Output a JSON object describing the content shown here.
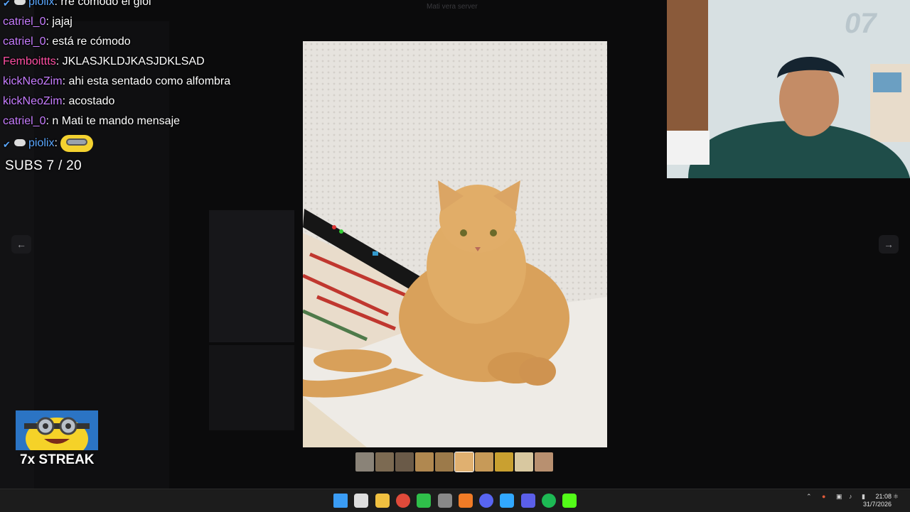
{
  "viewer": {
    "title": "Mati vera server"
  },
  "chat": [
    {
      "user": "piolix",
      "message": "rre comodo el giol",
      "color": "#5aa7ff",
      "badges": true
    },
    {
      "user": "catriel_0",
      "message": "jajaj",
      "color": "#c77dff"
    },
    {
      "user": "catriel_0",
      "message": "está re cómodo",
      "color": "#c77dff"
    },
    {
      "user": "Femboittts",
      "message": "JKLASJKLDJKASJDKLSAD",
      "color": "#ff4fa3"
    },
    {
      "user": "kickNeoZim",
      "message": "ahi esta sentado como alfombra",
      "color": "#c77dff"
    },
    {
      "user": "kickNeoZim",
      "message": "acostado",
      "color": "#c77dff"
    },
    {
      "user": "catriel_0",
      "message": "n Mati te mando mensaje",
      "color": "#c77dff"
    },
    {
      "user": "piolix",
      "message": "",
      "color": "#5aa7ff",
      "badges": true,
      "emote": "minion-emote"
    }
  ],
  "subs": "SUBS 7 / 20",
  "streak": "7x STREAK",
  "nav": {
    "prev_icon": "arrow-left-icon",
    "next_icon": "arrow-right-icon"
  },
  "thumbnails": {
    "count": 10,
    "active_index": 5
  },
  "taskbar": {
    "icons": [
      "windows-start-icon",
      "search-icon",
      "file-explorer-icon",
      "chrome-icon",
      "game-icon",
      "settings-icon",
      "brave-icon",
      "discord-icon",
      "photoshop-icon",
      "v-app-icon",
      "spotify-icon",
      "kick-icon"
    ],
    "icon_colors": [
      "#3a9cf5",
      "#dddddd",
      "#f0c040",
      "#e04a3a",
      "#2fbf4a",
      "#888888",
      "#f07b26",
      "#5865f2",
      "#31a8ff",
      "#5b5fe8",
      "#1db954",
      "#53fc18"
    ],
    "time": "21:08",
    "date": "31/7/2026"
  }
}
